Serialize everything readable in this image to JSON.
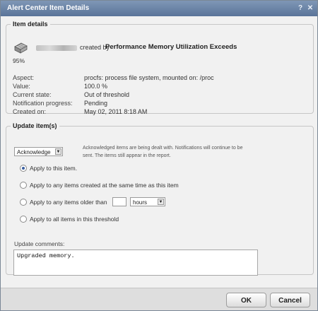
{
  "window": {
    "title": "Alert Center Item Details",
    "help_glyph": "?",
    "close_glyph": "✕"
  },
  "item_details": {
    "legend": "Item details",
    "created_by_text": "created by",
    "source": "Performance Memory Utilization Exceeds",
    "percent": "95%",
    "rows": [
      {
        "label": "Aspect:",
        "value": "procfs: process file system, mounted on: /proc"
      },
      {
        "label": "Value:",
        "value": "100.0 %"
      },
      {
        "label": "Current state:",
        "value": "Out of threshold"
      },
      {
        "label": "Notification progress:",
        "value": "Pending"
      },
      {
        "label": "Created on:",
        "value": "May 02, 2011 8:18 AM"
      }
    ]
  },
  "update_items": {
    "legend": "Update item(s)",
    "action_select": "Acknowledge",
    "info_text_line1": "Acknowledged items are being dealt with. Notifications will continue to be",
    "info_text_line2": "sent. The items still appear in the report.",
    "radio_this": "Apply to this item.",
    "radio_same_time": "Apply to any items created at the same time as this item",
    "radio_older": "Apply to any items older than",
    "older_unit": "hours",
    "radio_threshold": "Apply to all items in this threshold",
    "selected_option": "this",
    "comments_label": "Update comments:",
    "comments_value": "Upgraded memory."
  },
  "footer": {
    "ok_label": "OK",
    "cancel_label": "Cancel"
  }
}
